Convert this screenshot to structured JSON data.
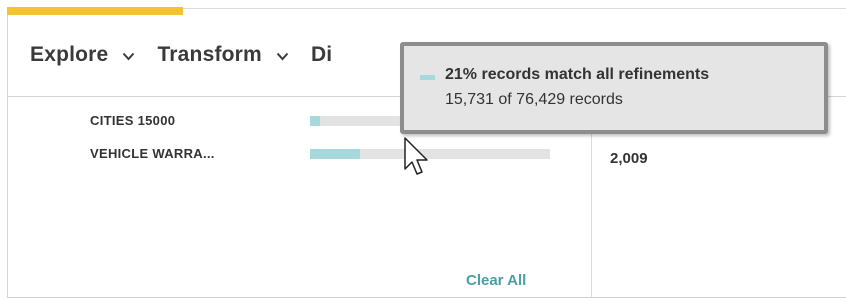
{
  "menu": {
    "items": [
      {
        "label": "Explore"
      },
      {
        "label": "Transform"
      },
      {
        "label": "Di"
      }
    ]
  },
  "refinements": {
    "rows": [
      {
        "label": "CITIES 15000",
        "fill_fraction": 0.04
      },
      {
        "label": "VEHICLE WARRA...",
        "fill_fraction": 0.21
      }
    ],
    "clear_all_label": "Clear All"
  },
  "right_panel": {
    "value": "2,009"
  },
  "tooltip": {
    "title": "21% records match all refinements",
    "subtitle": "15,731 of 76,429 records"
  },
  "colors": {
    "accent": "#f4c430",
    "bar_fill": "#a6d8dc",
    "bar_track": "#e3e3e3",
    "link": "#4a9ea4"
  }
}
